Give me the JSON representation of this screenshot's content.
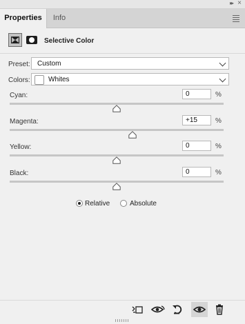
{
  "titlebar": {
    "collapse_icon": "double-chevron-right-icon",
    "close_icon": "close-icon"
  },
  "tabs": [
    {
      "label": "Properties",
      "active": true
    },
    {
      "label": "Info",
      "active": false
    }
  ],
  "panel_menu_icon": "hamburger-menu-icon",
  "header": {
    "title": "Selective Color",
    "adjustment_icon": "selective-color-adjustment-icon",
    "mask_icon": "layer-mask-icon"
  },
  "preset": {
    "label": "Preset:",
    "value": "Custom"
  },
  "colors": {
    "label": "Colors:",
    "value": "Whites",
    "swatch_color": "#ffffff"
  },
  "sliders": [
    {
      "id": "cyan",
      "label": "Cyan:",
      "value": "0",
      "unit": "%",
      "fraction": 0.5
    },
    {
      "id": "magenta",
      "label": "Magenta:",
      "value": "+15",
      "unit": "%",
      "fraction": 0.575
    },
    {
      "id": "yellow",
      "label": "Yellow:",
      "value": "0",
      "unit": "%",
      "fraction": 0.5
    },
    {
      "id": "black",
      "label": "Black:",
      "value": "0",
      "unit": "%",
      "fraction": 0.5
    }
  ],
  "method": {
    "options": [
      "Relative",
      "Absolute"
    ],
    "selected": "Relative"
  },
  "bottom_icons": [
    "clip-to-layer-icon",
    "view-previous-state-icon",
    "reset-icon",
    "toggle-visibility-icon",
    "trash-icon"
  ]
}
